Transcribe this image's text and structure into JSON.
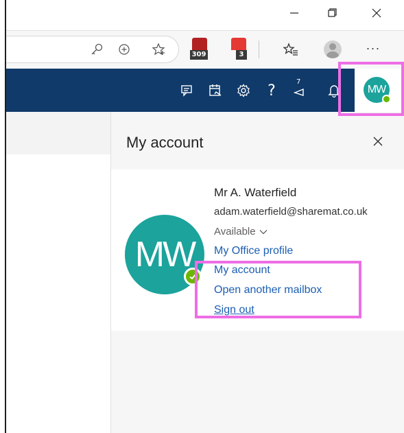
{
  "browser": {
    "window_controls": [
      "minimize-icon",
      "maximize-icon",
      "close-icon"
    ],
    "toolbar_icons": [
      "key-icon",
      "zoom-in-icon",
      "favorite-star-icon",
      "extension-calendar-icon",
      "extension-counter-icon",
      "favorites-icon",
      "profile-avatar-icon",
      "more-options-icon"
    ],
    "extensions": [
      {
        "badge": "309",
        "color": "#b22222"
      },
      {
        "badge": "3",
        "color": "#e53935"
      }
    ],
    "more_label": "···"
  },
  "outlook_header": {
    "background": "#103a69",
    "icons": [
      "chat-icon",
      "my-day-icon",
      "settings-gear-icon",
      "help-icon",
      "announcement-icon",
      "notifications-bell-icon"
    ],
    "help_label": "?",
    "announcement_count": "7",
    "avatar_initials": "MW",
    "avatar_color": "#1ba39c",
    "presence_color": "#6bb700"
  },
  "account_panel": {
    "title": "My account",
    "user": {
      "initials": "MW",
      "name": "Mr A. Waterfield",
      "email": "adam.waterfield@sharemat.co.uk",
      "status": "Available"
    },
    "links": {
      "office_profile": "My Office profile",
      "my_account": "My account",
      "open_mailbox": "Open another mailbox",
      "sign_out": "Sign out"
    },
    "link_color": "#1b5eb3"
  },
  "highlight_color": "#ee6ee5"
}
